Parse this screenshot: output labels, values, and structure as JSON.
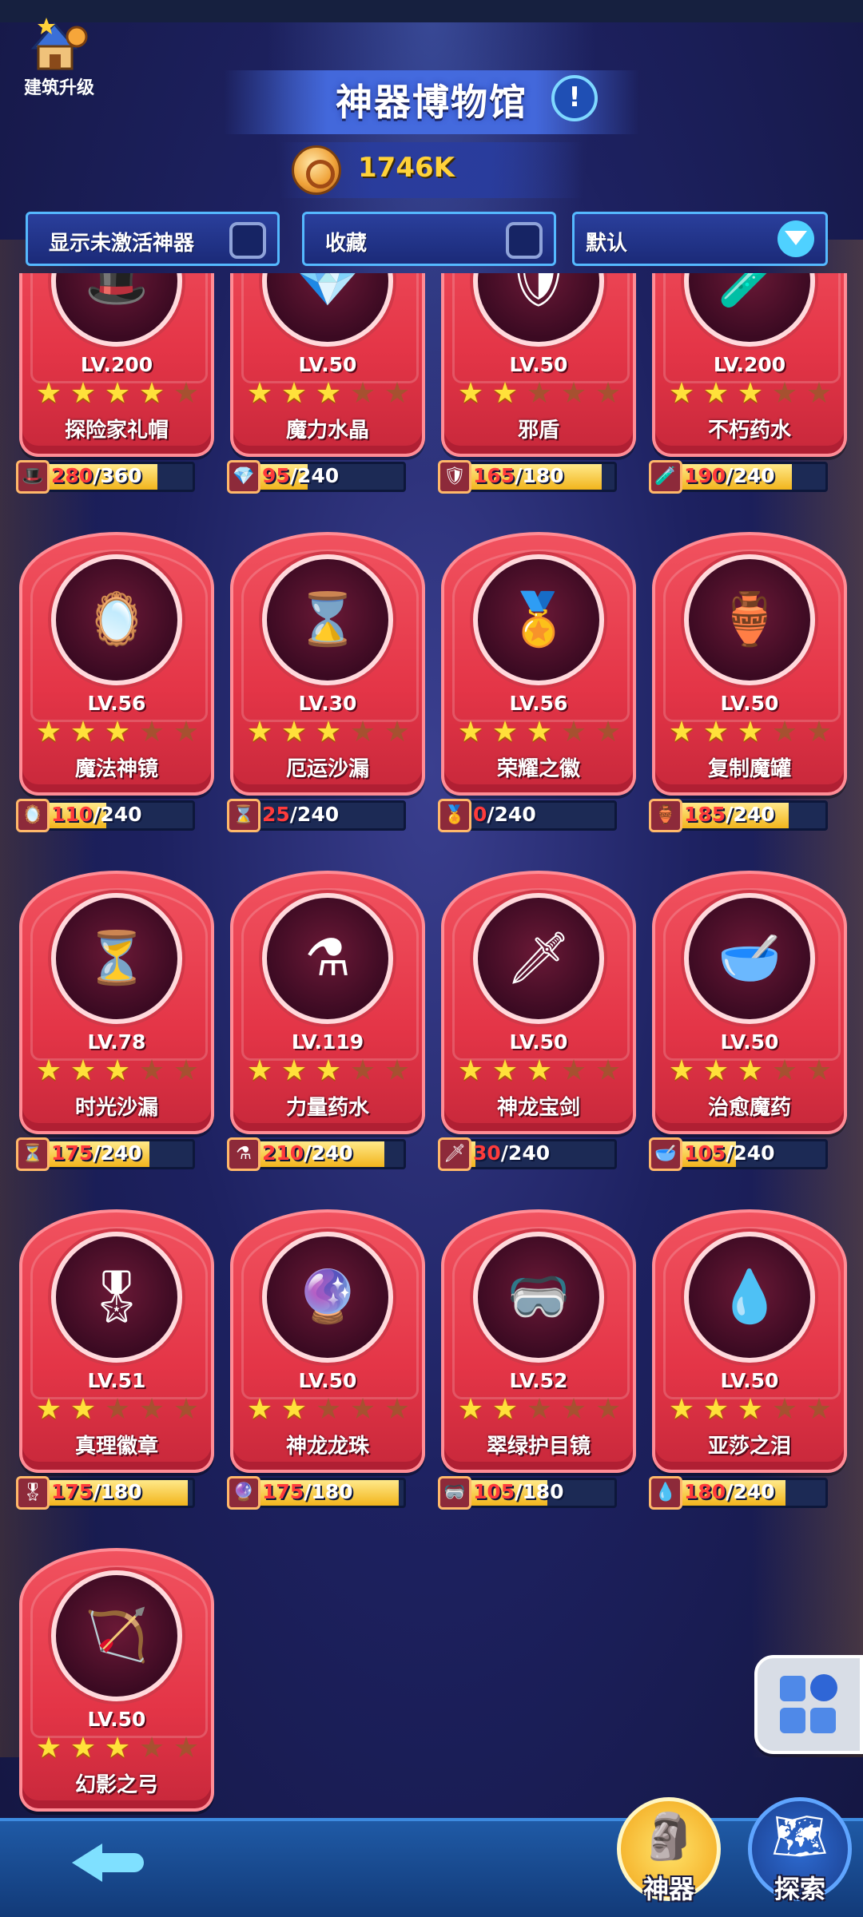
{
  "header": {
    "build_upgrade_label": "建筑升级",
    "title": "神器博物馆",
    "info_symbol": "!",
    "currency_amount": "1746K"
  },
  "filters": {
    "show_inactive_label": "显示未激活神器",
    "favorites_label": "收藏",
    "sort_label": "默认"
  },
  "artifacts": [
    {
      "name": "探险家礼帽",
      "level": "LV.200",
      "stars": 4,
      "current": "280",
      "total": "/360",
      "ratio": 0.78,
      "icon": "top-hat-icon",
      "glyph": "🎩"
    },
    {
      "name": "魔力水晶",
      "level": "LV.50",
      "stars": 3,
      "current": "95",
      "total": "/240",
      "ratio": 0.4,
      "icon": "crystal-icon",
      "glyph": "💎"
    },
    {
      "name": "邪盾",
      "level": "LV.50",
      "stars": 2,
      "current": "165",
      "total": "/180",
      "ratio": 0.92,
      "icon": "shield-icon",
      "glyph": "🛡"
    },
    {
      "name": "不朽药水",
      "level": "LV.200",
      "stars": 3,
      "current": "190",
      "total": "/240",
      "ratio": 0.79,
      "icon": "potion-icon",
      "glyph": "🧪"
    },
    {
      "name": "魔法神镜",
      "level": "LV.56",
      "stars": 3,
      "current": "110",
      "total": "/240",
      "ratio": 0.46,
      "icon": "mirror-icon",
      "glyph": "🪞"
    },
    {
      "name": "厄运沙漏",
      "level": "LV.30",
      "stars": 3,
      "current": "25",
      "total": "/240",
      "ratio": 0.1,
      "icon": "hourglass-icon",
      "glyph": "⌛"
    },
    {
      "name": "荣耀之徽",
      "level": "LV.56",
      "stars": 3,
      "current": "0",
      "total": "/240",
      "ratio": 0.0,
      "icon": "laurel-emblem-icon",
      "glyph": "🏅"
    },
    {
      "name": "复制魔罐",
      "level": "LV.50",
      "stars": 3,
      "current": "185",
      "total": "/240",
      "ratio": 0.77,
      "icon": "magic-jar-icon",
      "glyph": "🏺"
    },
    {
      "name": "时光沙漏",
      "level": "LV.78",
      "stars": 3,
      "current": "175",
      "total": "/240",
      "ratio": 0.73,
      "icon": "time-hourglass-icon",
      "glyph": "⏳"
    },
    {
      "name": "力量药水",
      "level": "LV.119",
      "stars": 3,
      "current": "210",
      "total": "/240",
      "ratio": 0.88,
      "icon": "strength-potion-icon",
      "glyph": "⚗"
    },
    {
      "name": "神龙宝剑",
      "level": "LV.50",
      "stars": 3,
      "current": "30",
      "total": "/240",
      "ratio": 0.13,
      "icon": "sword-icon",
      "glyph": "🗡"
    },
    {
      "name": "治愈魔药",
      "level": "LV.50",
      "stars": 3,
      "current": "105",
      "total": "/240",
      "ratio": 0.44,
      "icon": "cauldron-icon",
      "glyph": "🥣"
    },
    {
      "name": "真理徽章",
      "level": "LV.51",
      "stars": 2,
      "current": "175",
      "total": "/180",
      "ratio": 0.97,
      "icon": "medal-icon",
      "glyph": "🎖"
    },
    {
      "name": "神龙龙珠",
      "level": "LV.50",
      "stars": 2,
      "current": "175",
      "total": "/180",
      "ratio": 0.97,
      "icon": "dragon-pearls-icon",
      "glyph": "🔮"
    },
    {
      "name": "翠绿护目镜",
      "level": "LV.52",
      "stars": 2,
      "current": "105",
      "total": "/180",
      "ratio": 0.58,
      "icon": "goggles-icon",
      "glyph": "🥽"
    },
    {
      "name": "亚莎之泪",
      "level": "LV.50",
      "stars": 3,
      "current": "180",
      "total": "/240",
      "ratio": 0.75,
      "icon": "tear-flask-icon",
      "glyph": "💧"
    },
    {
      "name": "幻影之弓",
      "level": "LV.50",
      "stars": 3,
      "current": "",
      "total": "",
      "ratio": 0,
      "icon": "bow-icon",
      "glyph": "🏹"
    }
  ],
  "bottom_nav": {
    "artifacts_tab": "神器",
    "explore_tab": "探索"
  },
  "colors": {
    "card_red": "#e43547",
    "progress_gold": "#f2b51c",
    "current_red": "#ff3b3b",
    "accent_blue": "#4fd1ff"
  }
}
